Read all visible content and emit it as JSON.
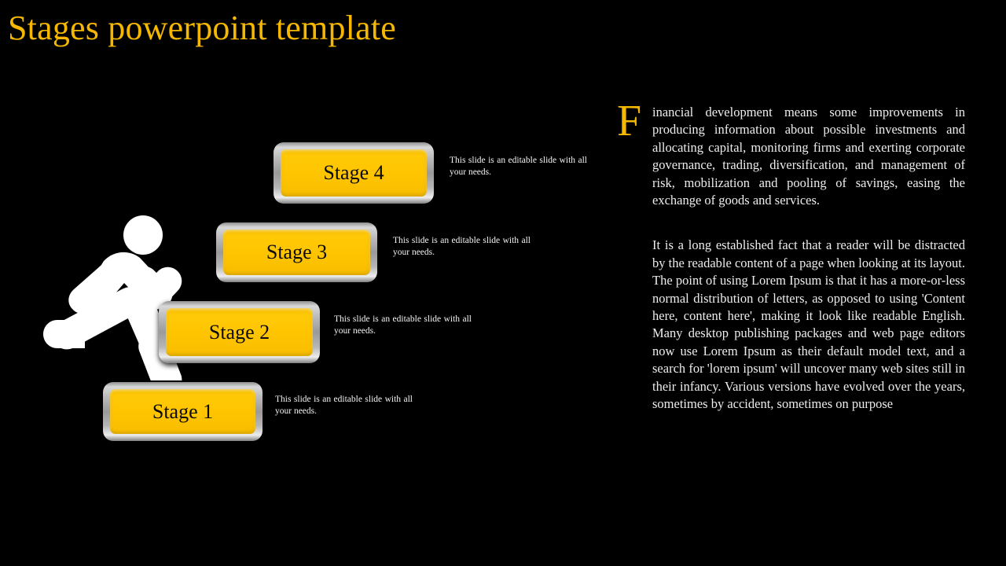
{
  "slide": {
    "title": "Stages powerpoint template",
    "background_color": "#000000",
    "accent_color": "#f5b700",
    "box_fill_color": "#ffc400",
    "box_frame_color": "#bdbdbd",
    "body_text_color": "#ededed"
  },
  "stages": [
    {
      "label": "Stage 4",
      "caption": "This slide is an editable slide with all your needs."
    },
    {
      "label": "Stage 3",
      "caption": "This slide is an editable slide with all your needs."
    },
    {
      "label": "Stage 2",
      "caption": "This slide is an editable slide with all your needs."
    },
    {
      "label": "Stage 1",
      "caption": "This slide is an editable slide with all your needs."
    }
  ],
  "figure": {
    "icon_name": "running-person-icon",
    "color": "#ffffff"
  },
  "body": {
    "dropcap": "F",
    "paragraph1": "inancial development means some improvements in producing information about possible investments and allocating capital, monitoring firms and exerting corporate governance, trading, diversification, and management of risk, mobilization and pooling of savings, easing the exchange of goods and services.",
    "paragraph2": "It is a long established fact that a reader will be distracted by the readable content of a page when looking at its layout. The point of using Lorem Ipsum is that it has a more-or-less normal distribution of letters, as opposed to using 'Content here, content here', making it look like readable English. Many desktop publishing packages and web page editors now use Lorem Ipsum as their default model text, and a search for 'lorem ipsum' will uncover many web sites still in their infancy. Various versions have evolved over the years, sometimes by accident, sometimes on purpose"
  }
}
